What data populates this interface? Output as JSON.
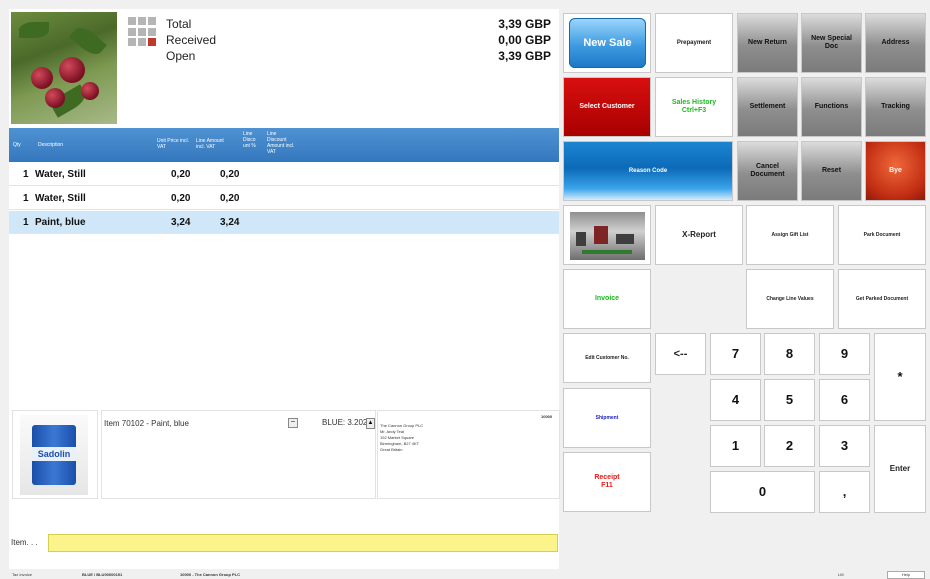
{
  "summary": {
    "total_label": "Total",
    "total_value": "3,39 GBP",
    "received_label": "Received",
    "received_value": "0,00 GBP",
    "open_label": "Open",
    "open_value": "3,39 GBP"
  },
  "grid": {
    "headers": [
      "Qty",
      "Description",
      "Unit Price incl. VAT",
      "Line Amount incl. VAT",
      "Line Disco unt %",
      "Line Discount Amount incl. VAT"
    ],
    "rows": [
      {
        "qty": "1",
        "description": "Water, Still",
        "unit_price": "0,20",
        "line_amount": "0,20"
      },
      {
        "qty": "1",
        "description": "Water, Still",
        "unit_price": "0,20",
        "line_amount": "0,20"
      },
      {
        "qty": "1",
        "description": "Paint, blue",
        "unit_price": "3,24",
        "line_amount": "3,24"
      }
    ]
  },
  "item_info": {
    "text": "Item 70102  -  Paint, blue",
    "minus_icon": "minus-icon",
    "variant": "BLUE: 3.202",
    "customer_no": "10000",
    "address": [
      "The Cannon Group PLC",
      "Mr. Andy Teal",
      "192 Market Square",
      "Birmingham, B27 4KT",
      "Great Britain"
    ],
    "can_label": "Sadolin"
  },
  "input": {
    "label": "Item. . ."
  },
  "status": {
    "left1": "Tax Invoice",
    "left2": "BLUE / BLU00000151",
    "left3": "10000 - The Cannon Group PLC",
    "right1": "LM",
    "right2": "Help"
  },
  "buttons": {
    "new_sale": "New Sale",
    "prepayment": "Prepayment",
    "new_return": "New Return",
    "new_special": "New Special\nDoc",
    "address": "Address",
    "select_customer": "Select Customer",
    "sales_history": "Sales History\nCtrl+F3",
    "settlement": "Settlement",
    "functions": "Functions",
    "tracking": "Tracking",
    "reason_code": "Reason Code",
    "cancel_document": "Cancel\nDocument",
    "reset": "Reset",
    "bye": "Bye",
    "x_report": "X-Report",
    "assign_gift": "Assign Gift List",
    "park_document": "Park Document",
    "invoice": "Invoice",
    "change_line": "Change Line Values",
    "get_parked": "Get Parked Document",
    "edit_customer": "Edit Customer No.",
    "backspace": "<--",
    "shipment": "Shipment",
    "receipt": "Receipt\nF11",
    "n7": "7",
    "n8": "8",
    "n9": "9",
    "star": "*",
    "n4": "4",
    "n5": "5",
    "n6": "6",
    "n1": "1",
    "n2": "2",
    "n3": "3",
    "enter": "Enter",
    "n0": "0",
    "comma": ","
  }
}
